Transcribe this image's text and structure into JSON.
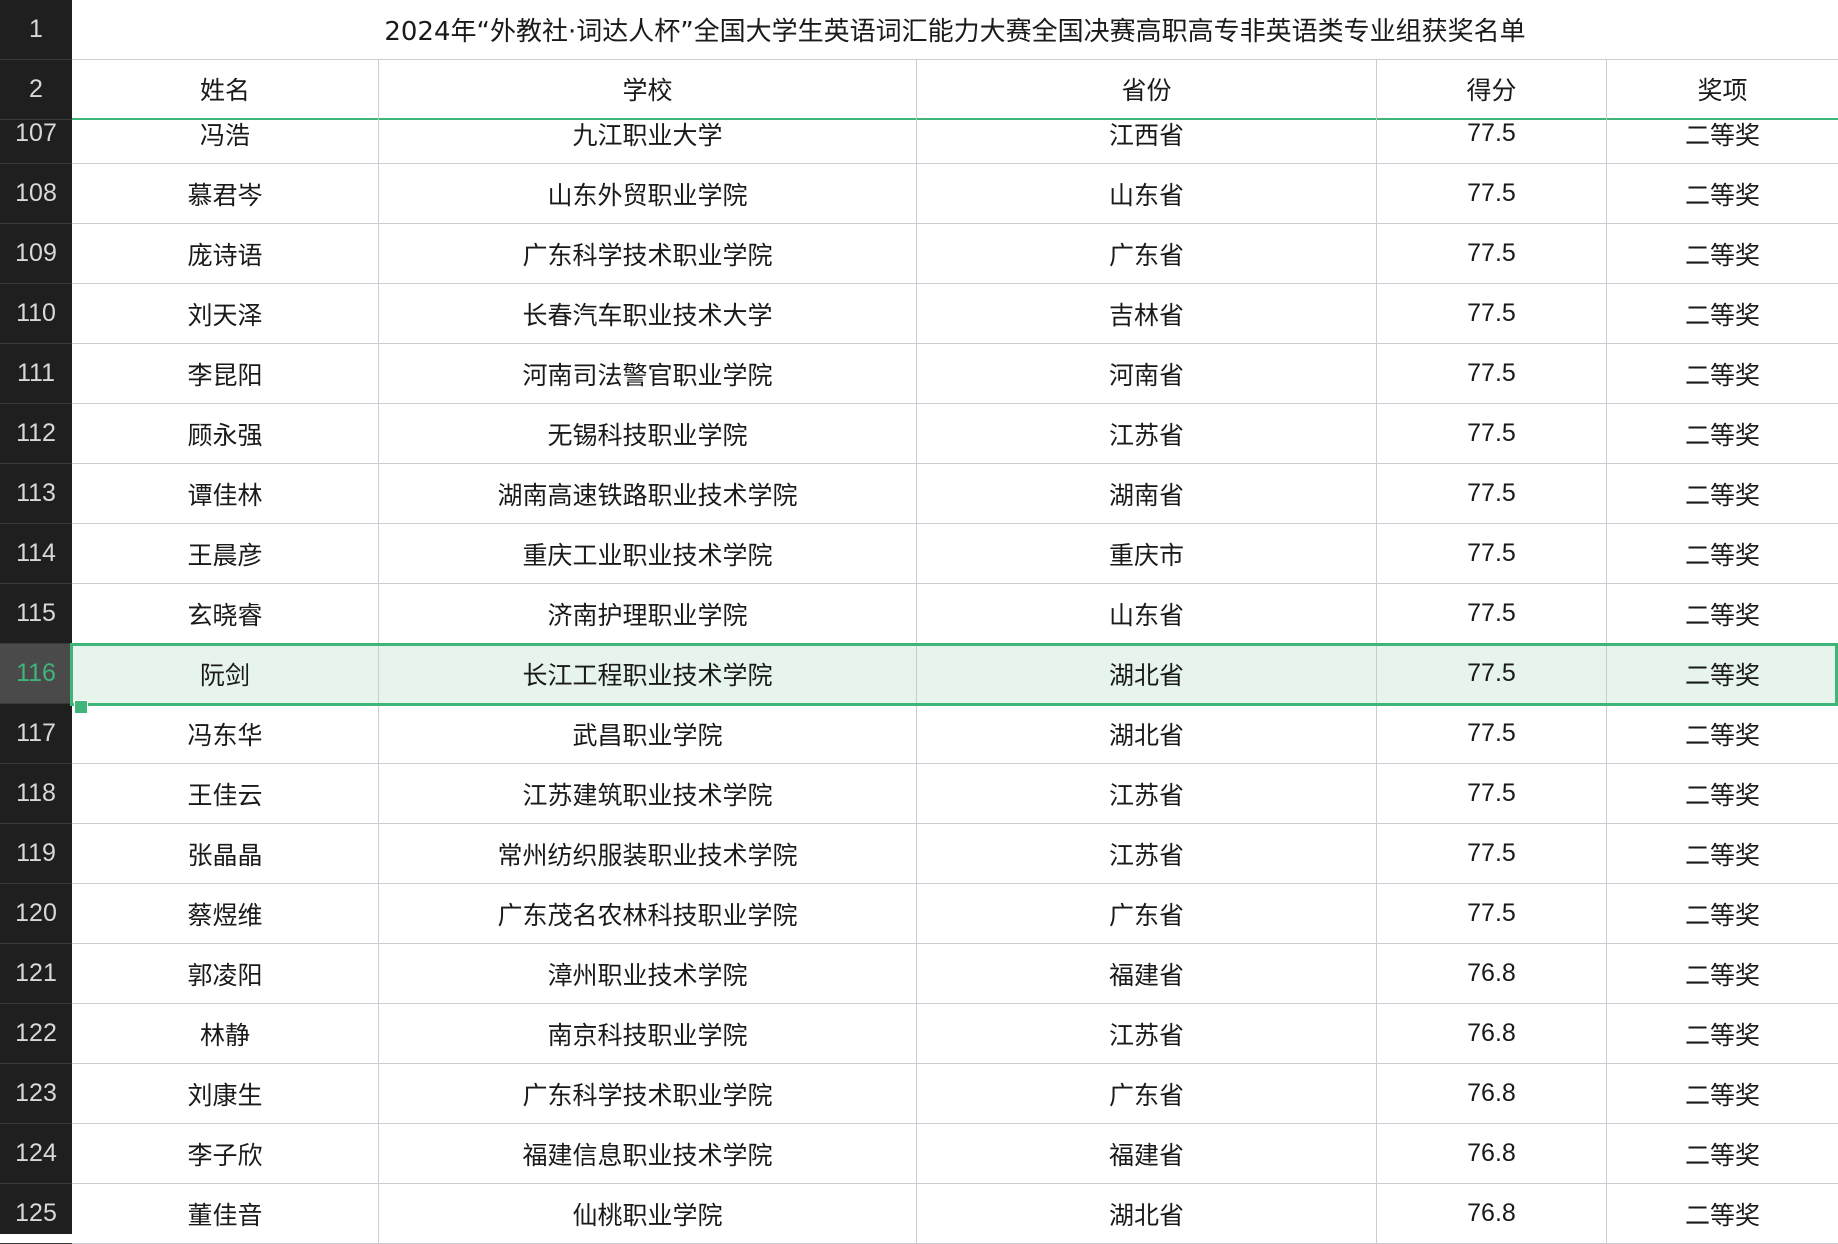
{
  "title": "2024年“外教社·词达人杯”全国大学生英语词汇能力大赛全国决赛高职高专非英语类专业组获奖名单",
  "header_row_numbers": [
    "1",
    "2"
  ],
  "columns": [
    "姓名",
    "学校",
    "省份",
    "得分",
    "奖项"
  ],
  "selected_row": "116",
  "rows": [
    {
      "n": "107",
      "name": "冯浩",
      "school": "九江职业大学",
      "province": "江西省",
      "score": "77.5",
      "award": "二等奖"
    },
    {
      "n": "108",
      "name": "慕君岑",
      "school": "山东外贸职业学院",
      "province": "山东省",
      "score": "77.5",
      "award": "二等奖"
    },
    {
      "n": "109",
      "name": "庞诗语",
      "school": "广东科学技术职业学院",
      "province": "广东省",
      "score": "77.5",
      "award": "二等奖"
    },
    {
      "n": "110",
      "name": "刘天泽",
      "school": "长春汽车职业技术大学",
      "province": "吉林省",
      "score": "77.5",
      "award": "二等奖"
    },
    {
      "n": "111",
      "name": "李昆阳",
      "school": "河南司法警官职业学院",
      "province": "河南省",
      "score": "77.5",
      "award": "二等奖"
    },
    {
      "n": "112",
      "name": "顾永强",
      "school": "无锡科技职业学院",
      "province": "江苏省",
      "score": "77.5",
      "award": "二等奖"
    },
    {
      "n": "113",
      "name": "谭佳林",
      "school": "湖南高速铁路职业技术学院",
      "province": "湖南省",
      "score": "77.5",
      "award": "二等奖"
    },
    {
      "n": "114",
      "name": "王晨彦",
      "school": "重庆工业职业技术学院",
      "province": "重庆市",
      "score": "77.5",
      "award": "二等奖"
    },
    {
      "n": "115",
      "name": "玄晓睿",
      "school": "济南护理职业学院",
      "province": "山东省",
      "score": "77.5",
      "award": "二等奖"
    },
    {
      "n": "116",
      "name": "阮剑",
      "school": "长江工程职业技术学院",
      "province": "湖北省",
      "score": "77.5",
      "award": "二等奖"
    },
    {
      "n": "117",
      "name": "冯东华",
      "school": "武昌职业学院",
      "province": "湖北省",
      "score": "77.5",
      "award": "二等奖"
    },
    {
      "n": "118",
      "name": "王佳云",
      "school": "江苏建筑职业技术学院",
      "province": "江苏省",
      "score": "77.5",
      "award": "二等奖"
    },
    {
      "n": "119",
      "name": "张晶晶",
      "school": "常州纺织服装职业技术学院",
      "province": "江苏省",
      "score": "77.5",
      "award": "二等奖"
    },
    {
      "n": "120",
      "name": "蔡煜维",
      "school": "广东茂名农林科技职业学院",
      "province": "广东省",
      "score": "77.5",
      "award": "二等奖"
    },
    {
      "n": "121",
      "name": "郭凌阳",
      "school": "漳州职业技术学院",
      "province": "福建省",
      "score": "76.8",
      "award": "二等奖"
    },
    {
      "n": "122",
      "name": "林静",
      "school": "南京科技职业学院",
      "province": "江苏省",
      "score": "76.8",
      "award": "二等奖"
    },
    {
      "n": "123",
      "name": "刘康生",
      "school": "广东科学技术职业学院",
      "province": "广东省",
      "score": "76.8",
      "award": "二等奖"
    },
    {
      "n": "124",
      "name": "李子欣",
      "school": "福建信息职业技术学院",
      "province": "福建省",
      "score": "76.8",
      "award": "二等奖"
    },
    {
      "n": "125",
      "name": "董佳音",
      "school": "仙桃职业学院",
      "province": "湖北省",
      "score": "76.8",
      "award": "二等奖"
    }
  ]
}
